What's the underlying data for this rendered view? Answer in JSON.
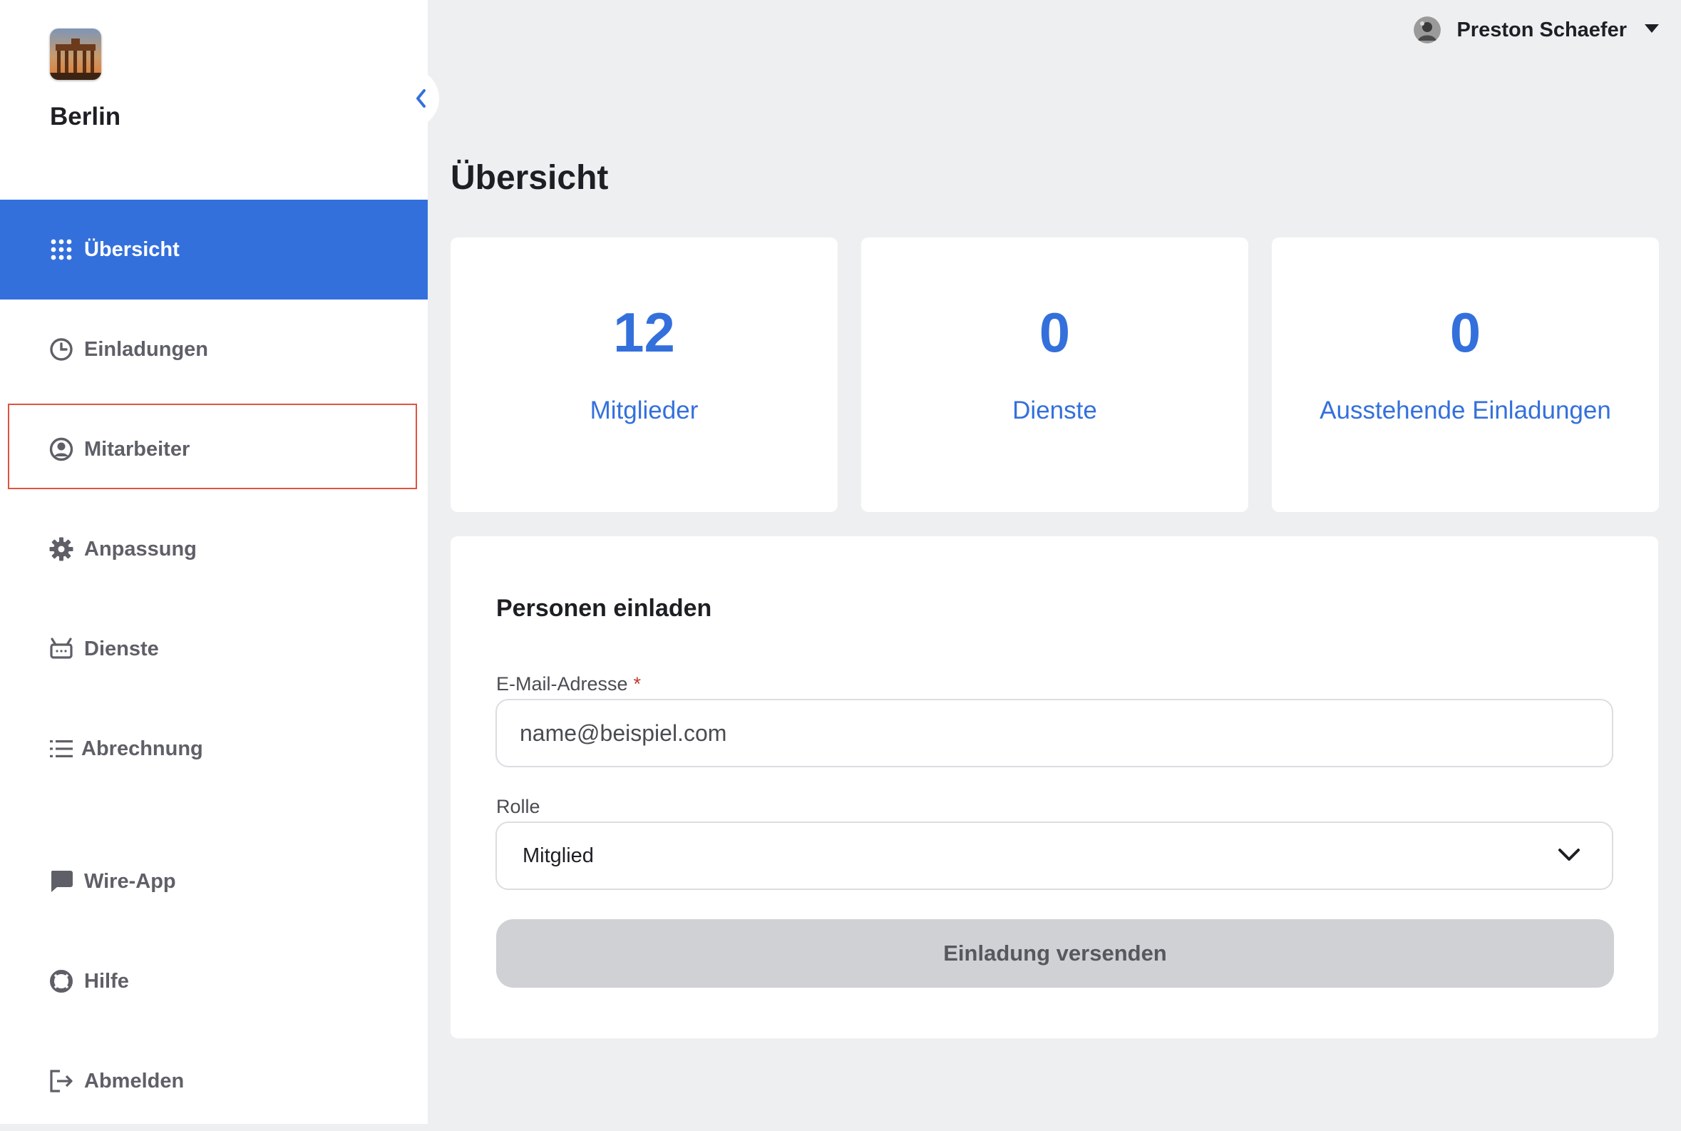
{
  "brand": {
    "name": "Berlin",
    "logo_icon": "brandenburg-gate-logo"
  },
  "sidebar": {
    "items": [
      {
        "label": "Übersicht",
        "icon": "grid-icon",
        "active": true
      },
      {
        "label": "Einladungen",
        "icon": "clock-icon"
      },
      {
        "label": "Mitarbeiter",
        "icon": "user-circle-icon"
      },
      {
        "label": "Anpassung",
        "icon": "gear-icon"
      },
      {
        "label": "Dienste",
        "icon": "robot-icon"
      },
      {
        "label": "Abrechnung",
        "icon": "list-icon"
      },
      {
        "label": "Wire-App",
        "icon": "chat-bubble-icon"
      },
      {
        "label": "Hilfe",
        "icon": "lifebuoy-icon"
      },
      {
        "label": "Abmelden",
        "icon": "logout-icon"
      }
    ]
  },
  "header": {
    "user_name": "Preston Schaefer"
  },
  "main": {
    "title": "Übersicht",
    "stats": [
      {
        "value": "12",
        "label": "Mitglieder"
      },
      {
        "value": "0",
        "label": "Dienste"
      },
      {
        "value": "0",
        "label": "Ausstehende Einladungen"
      }
    ],
    "invite": {
      "title": "Personen einladen",
      "email_label": "E-Mail-Adresse",
      "email_required_marker": "*",
      "email_placeholder": "name@beispiel.com",
      "role_label": "Rolle",
      "role_value": "Mitglied",
      "send_label": "Einladung versenden"
    }
  },
  "colors": {
    "accent": "#3470dc",
    "highlight": "#e0533f",
    "background": "#eeeff1"
  }
}
